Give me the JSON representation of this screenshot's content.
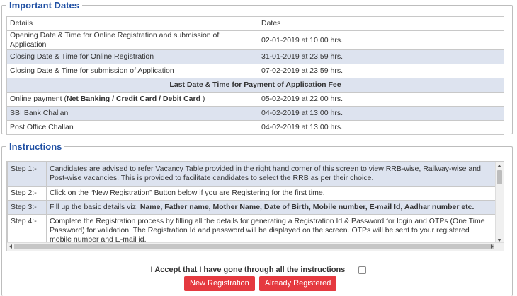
{
  "dates_section": {
    "legend": "Important Dates",
    "header": {
      "details": "Details",
      "dates": "Dates"
    },
    "rows": [
      {
        "details": "Opening Date & Time for Online Registration and submission of Application",
        "date": "02-01-2019 at 10.00 hrs."
      },
      {
        "details": "Closing Date & Time for Online Registration",
        "date": "31-01-2019 at 23.59 hrs."
      },
      {
        "details": "Closing Date & Time for submission of Application",
        "date": "07-02-2019 at 23.59 hrs."
      }
    ],
    "fee_section_title": "Last Date & Time for Payment of Application Fee",
    "fee_rows": [
      {
        "details_prefix": "Online payment (",
        "details_bold": "Net Banking / Credit Card / Debit Card",
        "details_suffix": " )",
        "date": "05-02-2019 at 22.00 hrs."
      },
      {
        "details": "SBI Bank Challan",
        "date": "04-02-2019 at 13.00 hrs."
      },
      {
        "details": "Post Office Challan",
        "date": "04-02-2019 at 13.00 hrs."
      }
    ]
  },
  "instructions_section": {
    "legend": "Instructions",
    "steps": [
      {
        "label": "Step 1:-",
        "text": "Candidates are advised to refer Vacancy Table provided in the right hand corner of this screen to view RRB-wise, Railway-wise and Post-wise vacancies. This is provided to facilitate candidates to select the RRB as per their choice."
      },
      {
        "label": "Step 2:-",
        "text": "Click on the “New Registration” Button below if you are Registering for the first time."
      },
      {
        "label": "Step 3:-",
        "text_prefix": "Fill up the basic details viz. ",
        "text_bold": "Name, Father name, Mother Name, Date of Birth, Mobile number, E-mail Id, Aadhar number etc."
      },
      {
        "label": "Step 4:-",
        "text": "Complete the Registration process by filling all the details for generating a Registration Id & Password for login and OTPs (One Time Password) for validation. The Registration Id and password will be displayed on the screen. OTPs will be sent to your registered mobile number and E-mail id."
      }
    ]
  },
  "accept": {
    "label": "I Accept that I have gone through all the instructions",
    "checked": false
  },
  "buttons": {
    "new_registration": "New Registration",
    "already_registered": "Already Registered"
  },
  "colors": {
    "legend": "#1f4fa3",
    "row_alt": "#dde3ef",
    "button": "#e5393f"
  }
}
